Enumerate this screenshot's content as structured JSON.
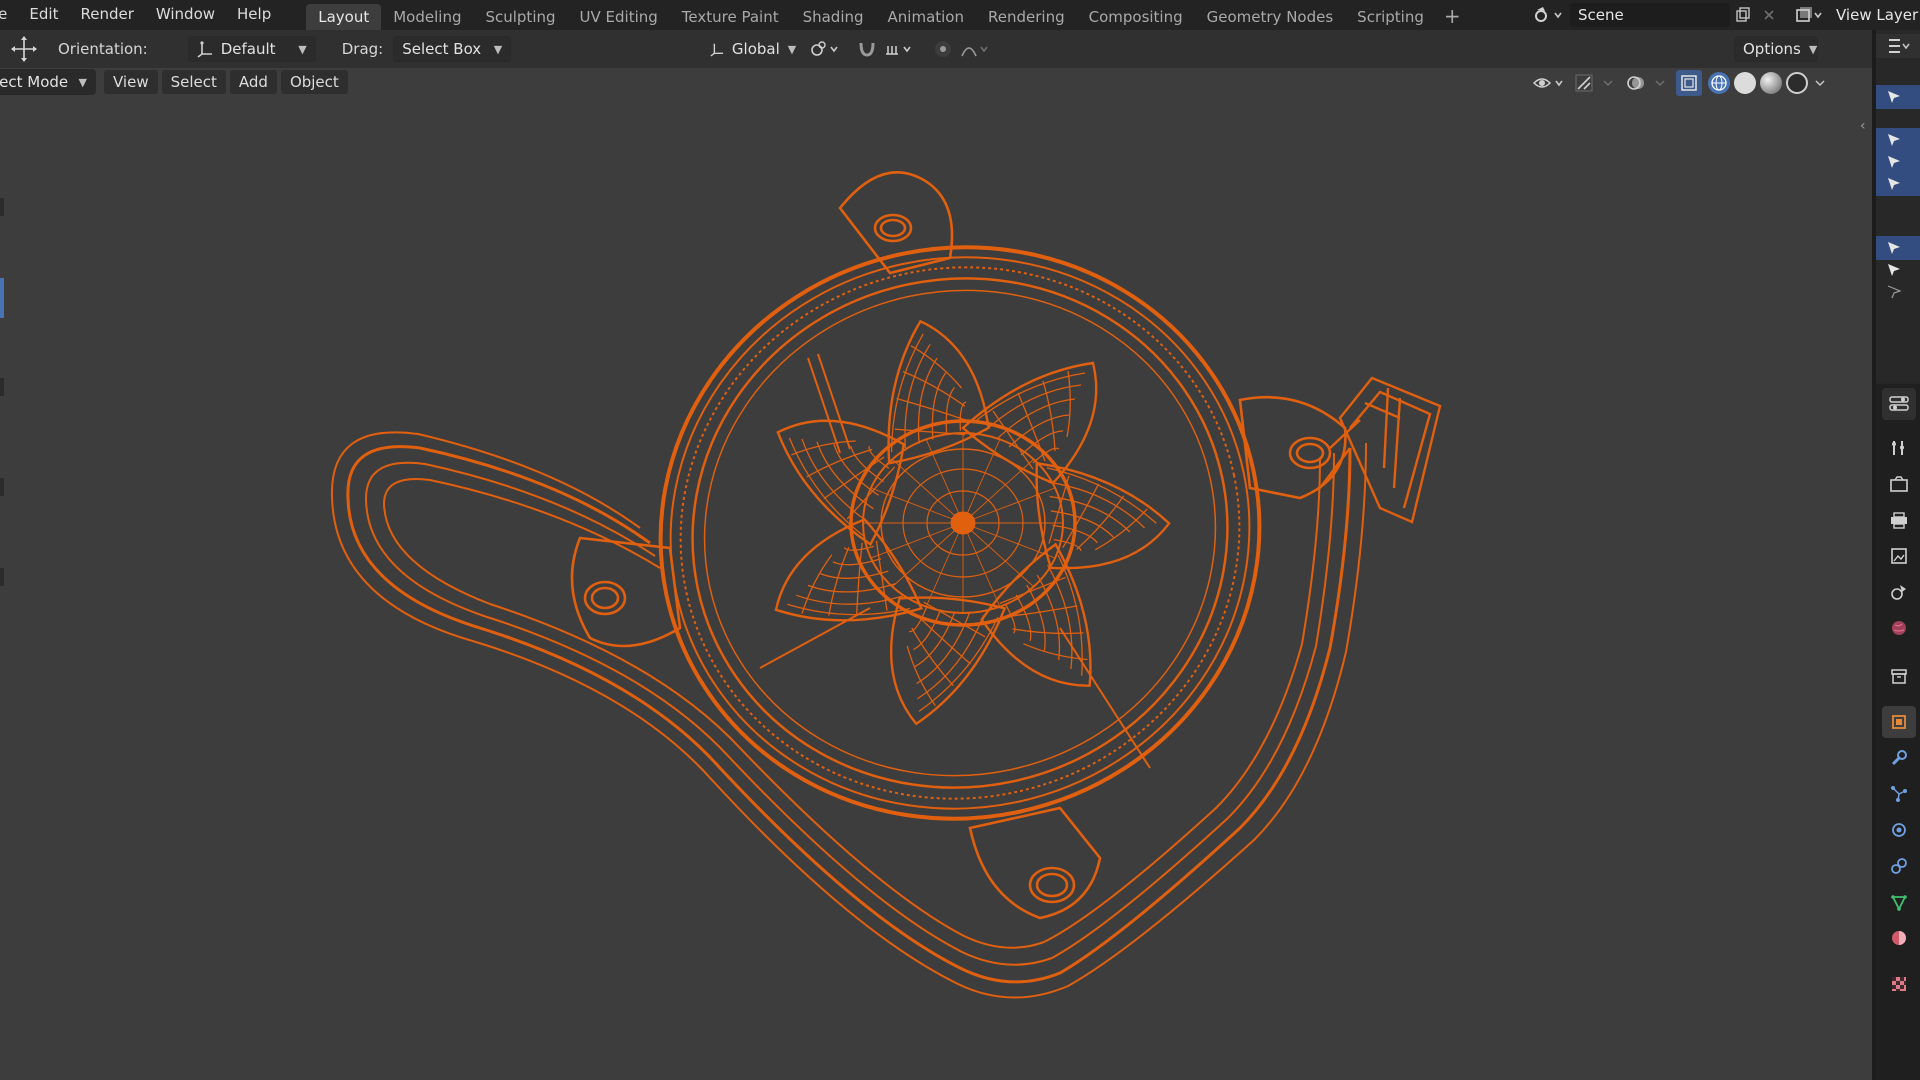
{
  "menu": {
    "items": [
      "le",
      "Edit",
      "Render",
      "Window",
      "Help"
    ]
  },
  "workspaces": {
    "tabs": [
      "Layout",
      "Modeling",
      "Sculpting",
      "UV Editing",
      "Texture Paint",
      "Shading",
      "Animation",
      "Rendering",
      "Compositing",
      "Geometry Nodes",
      "Scripting"
    ],
    "active": "Layout",
    "add_label": "+"
  },
  "scene": {
    "name": "Scene"
  },
  "view_layer": {
    "label": "View Layer"
  },
  "toolheader": {
    "orientation_label": "Orientation:",
    "orientation_value": "Default",
    "drag_label": "Drag:",
    "drag_value": "Select Box",
    "transform_orientation": "Global",
    "options_label": "Options"
  },
  "viewport_header": {
    "mode": "ject Mode",
    "menus": [
      "View",
      "Select",
      "Add",
      "Object"
    ]
  },
  "colors": {
    "wire": "#e0600f",
    "wire_dark": "#b84a0a",
    "selection_blue": "#334d80",
    "background": "#3d3d3d"
  },
  "icons": {
    "move": "move-cross-icon",
    "orientation": "orientation-axes-icon",
    "pivot": "pivot-point-icon",
    "snap": "magnet-snap-icon",
    "proportional": "proportional-edit-icon",
    "visibility": "eye-visibility-icon",
    "gizmo": "gizmo-icon",
    "overlay": "overlay-icon",
    "xray": "xray-icon",
    "shading_wire": "wireframe-shading-icon",
    "shading_solid": "solid-shading-icon",
    "shading_material": "material-shading-icon",
    "shading_render": "rendered-shading-icon"
  },
  "outliner": {
    "rows": [
      {
        "selected": true
      },
      {
        "selected": false
      },
      {
        "selected": true
      },
      {
        "selected": true
      },
      {
        "selected": true
      },
      {
        "selected": false
      },
      {
        "selected": false
      },
      {
        "selected": true
      },
      {
        "selected": false
      },
      {
        "selected": false
      }
    ]
  },
  "properties_tabs": [
    "tool",
    "render",
    "output",
    "view-layer",
    "scene",
    "world",
    "collection",
    "object",
    "modifier",
    "particles",
    "physics",
    "constraints",
    "data",
    "material",
    "texture"
  ]
}
